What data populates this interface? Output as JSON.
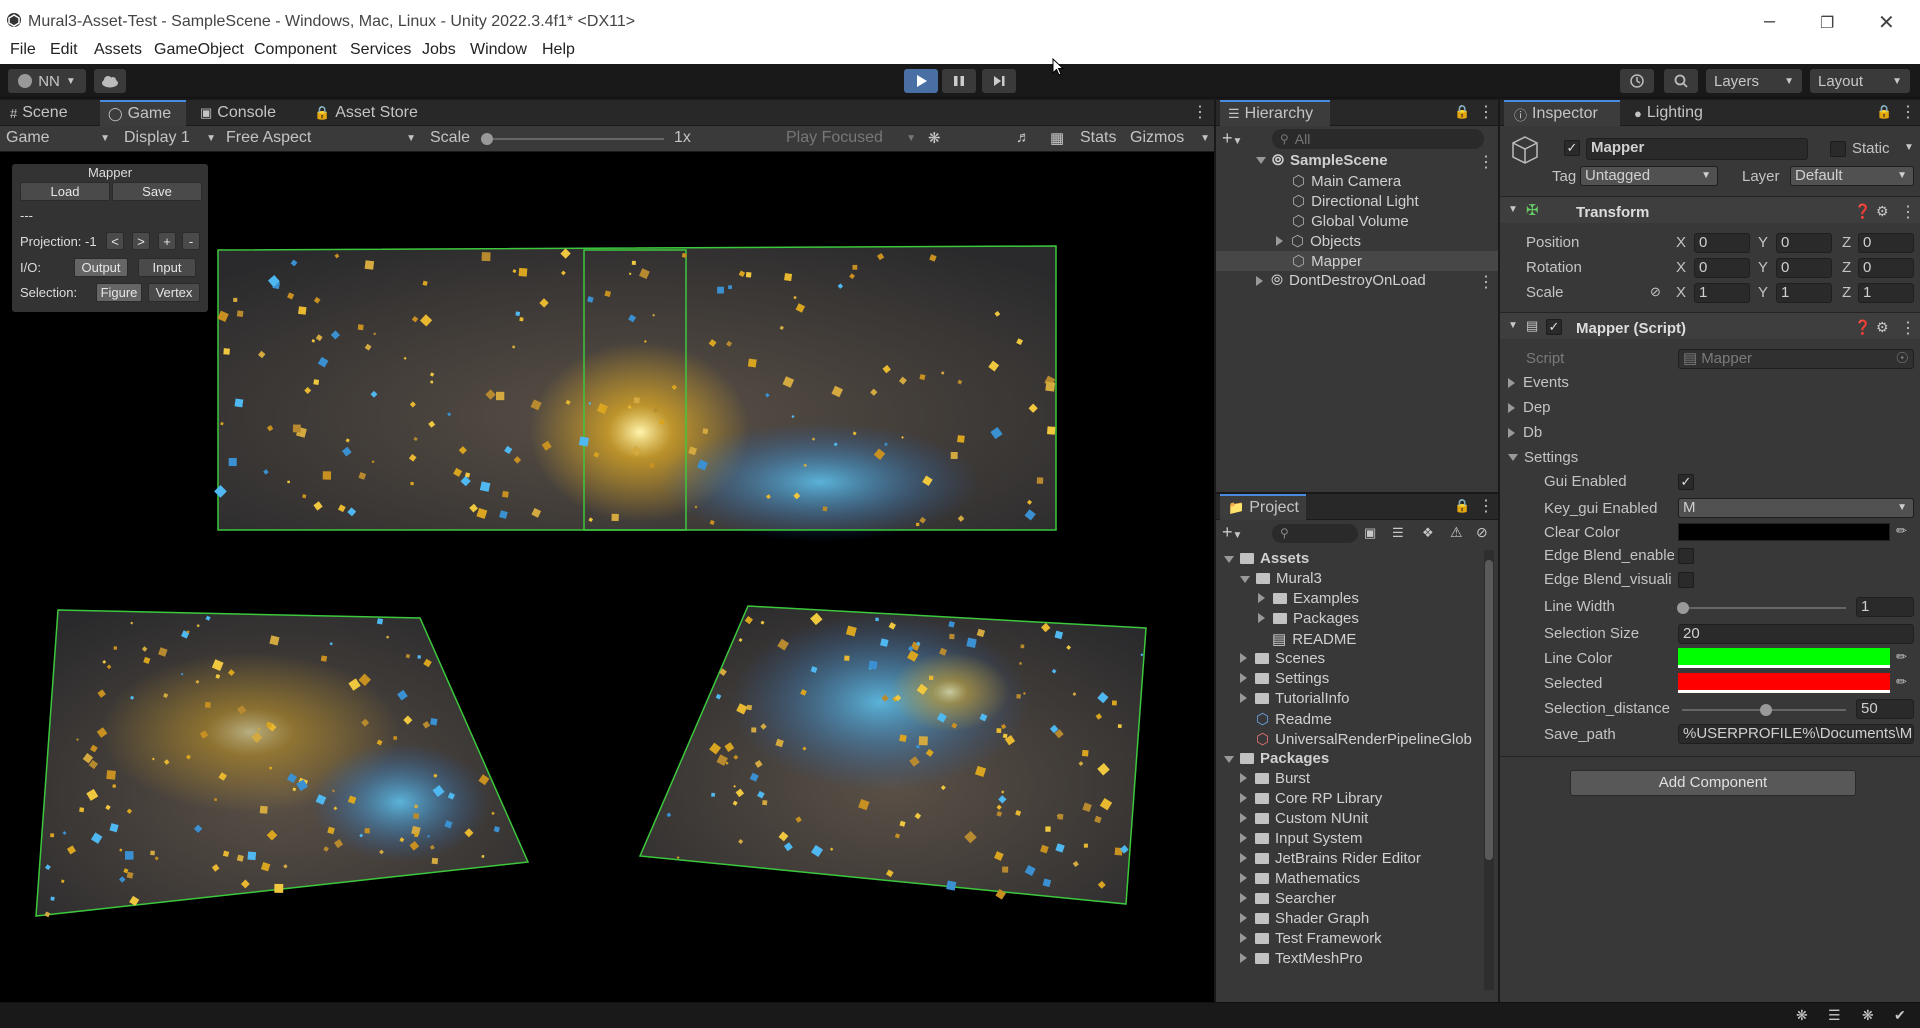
{
  "window": {
    "title": "Mural3-Asset-Test - SampleScene - Windows, Mac, Linux - Unity 2022.3.4f1* <DX11>"
  },
  "menu": [
    "File",
    "Edit",
    "Assets",
    "GameObject",
    "Component",
    "Services",
    "Jobs",
    "Window",
    "Help"
  ],
  "toolbar": {
    "account": "NN",
    "layers": "Layers",
    "layout": "Layout"
  },
  "game_tabs": {
    "scene": "Scene",
    "game": "Game",
    "console": "Console",
    "asset_store": "Asset Store"
  },
  "game_controls": {
    "mode": "Game",
    "display": "Display 1",
    "aspect": "Free Aspect",
    "scale_label": "Scale",
    "scale_value": "1x",
    "play_focused": "Play Focused",
    "stats": "Stats",
    "gizmos": "Gizmos"
  },
  "mapper_gui": {
    "title": "Mapper",
    "load": "Load",
    "save": "Save",
    "dashes": "---",
    "projection_label": "Projection: -1",
    "prev": "<",
    "next": ">",
    "plus": "+",
    "minus": "-",
    "io_label": "I/O:",
    "output": "Output",
    "input": "Input",
    "selection_label": "Selection:",
    "figure": "Figure",
    "vertex": "Vertex"
  },
  "hierarchy": {
    "title": "Hierarchy",
    "search_placeholder": "All",
    "scene": "SampleScene",
    "items": [
      "Main Camera",
      "Directional Light",
      "Global Volume",
      "Objects",
      "Mapper"
    ],
    "dont_destroy": "DontDestroyOnLoad"
  },
  "project": {
    "title": "Project",
    "assets_root": "Assets",
    "mural3": "Mural3",
    "mural3_children": [
      "Examples",
      "Packages",
      "README"
    ],
    "assets_children": [
      "Scenes",
      "Settings",
      "TutorialInfo",
      "Readme",
      "UniversalRenderPipelineGlob"
    ],
    "packages_root": "Packages",
    "packages": [
      "Burst",
      "Core RP Library",
      "Custom NUnit",
      "Input System",
      "JetBrains Rider Editor",
      "Mathematics",
      "Searcher",
      "Shader Graph",
      "Test Framework",
      "TextMeshPro"
    ]
  },
  "inspector": {
    "tab_inspector": "Inspector",
    "tab_lighting": "Lighting",
    "object_name": "Mapper",
    "static_label": "Static",
    "tag_label": "Tag",
    "tag_value": "Untagged",
    "layer_label": "Layer",
    "layer_value": "Default",
    "transform": {
      "title": "Transform",
      "position_label": "Position",
      "position": [
        "0",
        "0",
        "0"
      ],
      "rotation_label": "Rotation",
      "rotation": [
        "0",
        "0",
        "0"
      ],
      "scale_label": "Scale",
      "scale": [
        "1",
        "1",
        "1"
      ],
      "x": "X",
      "y": "Y",
      "z": "Z"
    },
    "script_component": {
      "title": "Mapper (Script)",
      "script_label": "Script",
      "script_value": "Mapper",
      "events": "Events",
      "dep": "Dep",
      "db": "Db",
      "settings": "Settings",
      "gui_enabled_label": "Gui Enabled",
      "key_gui_label": "Key_gui Enabled",
      "key_gui_value": "M",
      "clear_color_label": "Clear Color",
      "edge_blend_enable_label": "Edge Blend_enable",
      "edge_blend_visual_label": "Edge Blend_visuali",
      "line_width_label": "Line Width",
      "line_width_value": "1",
      "selection_size_label": "Selection Size",
      "selection_size_value": "20",
      "line_color_label": "Line Color",
      "selected_label": "Selected",
      "selection_distance_label": "Selection_distance",
      "selection_distance_value": "50",
      "save_path_label": "Save_path",
      "save_path_value": "%USERPROFILE%\\Documents\\M"
    },
    "add_component": "Add Component"
  },
  "colors": {
    "accent": "#4a8ae0",
    "line_color": "#00ff00",
    "selected_color": "#ff0000",
    "clear_color": "#000000"
  },
  "icons": [
    "unity-logo-icon",
    "play-icon",
    "pause-icon",
    "step-icon",
    "cloud-icon",
    "history-icon",
    "search-icon",
    "lock-icon",
    "kebab-menu-icon",
    "gameobject-icon",
    "help-icon",
    "settings-sliders-icon"
  ]
}
